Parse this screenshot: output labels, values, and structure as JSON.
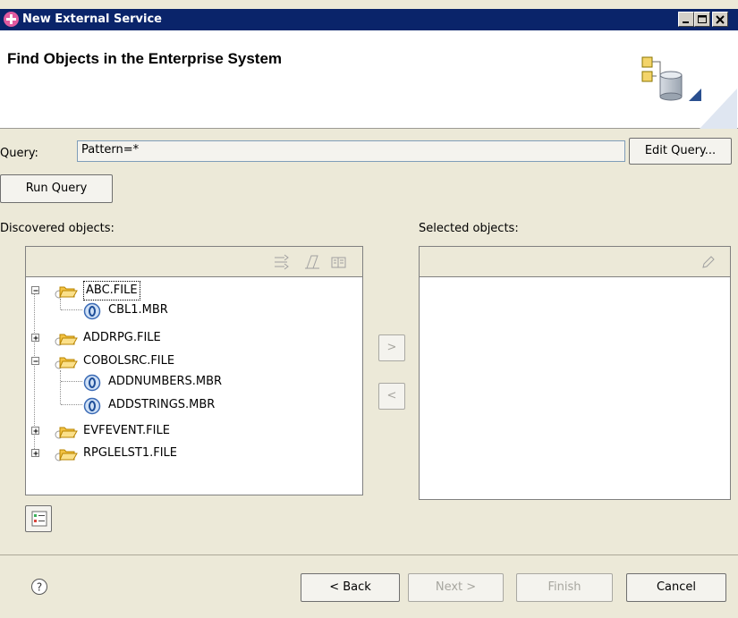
{
  "window": {
    "title": "New External Service",
    "controls": [
      "minimize",
      "maximize",
      "close"
    ]
  },
  "header": {
    "page_title": "Find Objects in the Enterprise System",
    "image_icon": "database-wizard-icon"
  },
  "query": {
    "label": "Query:",
    "value": "Pattern=*",
    "edit_button": "Edit Query...",
    "run_button": "Run Query"
  },
  "discovered": {
    "label": "Discovered objects:",
    "toolbar_icons": [
      "filter-icon",
      "edit-properties-icon",
      "view-details-icon"
    ],
    "tree": [
      {
        "label": "ABC.FILE",
        "type": "folder",
        "expanded": true,
        "focused": true
      },
      {
        "label": "CBL1.MBR",
        "type": "member"
      },
      {
        "label": "ADDRPG.FILE",
        "type": "folder",
        "expanded": false
      },
      {
        "label": "COBOLSRC.FILE",
        "type": "folder",
        "expanded": true
      },
      {
        "label": "ADDNUMBERS.MBR",
        "type": "member"
      },
      {
        "label": "ADDSTRINGS.MBR",
        "type": "member"
      },
      {
        "label": "EVFEVENT.FILE",
        "type": "folder",
        "expanded": false
      },
      {
        "label": "RPGLELST1.FILE",
        "type": "folder",
        "expanded": false
      }
    ]
  },
  "transfer": {
    "add_label": ">",
    "remove_label": "<"
  },
  "selected": {
    "label": "Selected objects:",
    "toolbar_icons": [
      "edit-icon"
    ]
  },
  "footer": {
    "help_icon": "help-icon",
    "back": "< Back",
    "next": "Next >",
    "finish": "Finish",
    "cancel": "Cancel"
  }
}
